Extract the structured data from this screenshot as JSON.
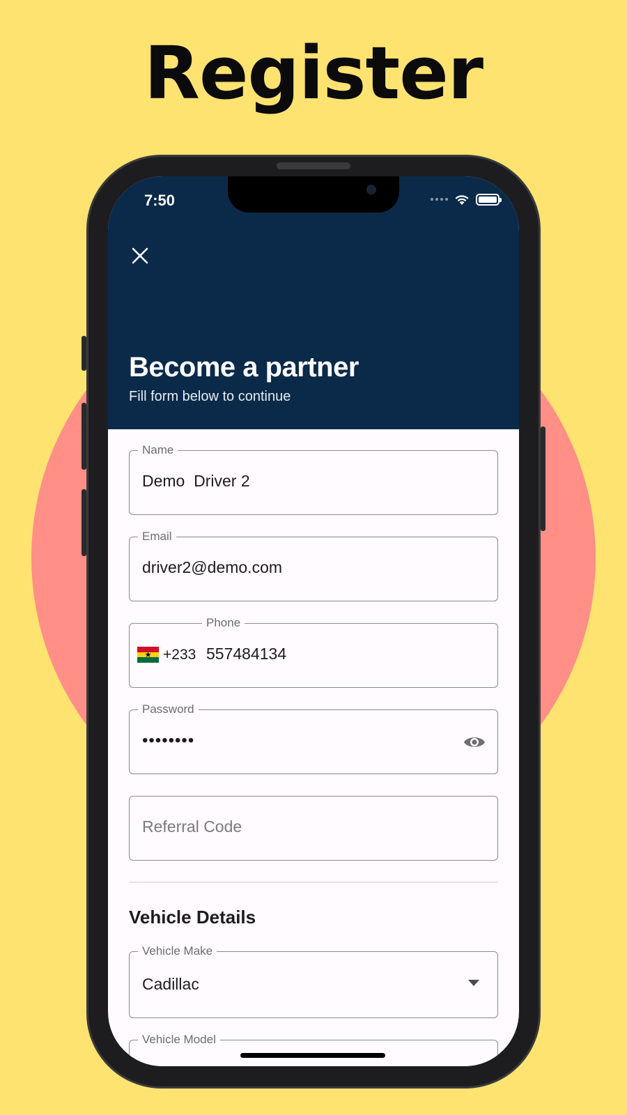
{
  "headline": "Register",
  "status_bar": {
    "time": "7:50"
  },
  "header": {
    "title": "Become a partner",
    "subtitle": "Fill form below to continue"
  },
  "form": {
    "name": {
      "label": "Name",
      "value": "Demo  Driver 2"
    },
    "email": {
      "label": "Email",
      "value": "driver2@demo.com"
    },
    "phone": {
      "label": "Phone",
      "dial_code": "+233",
      "value": "557484134",
      "country_flag": "ghana-flag"
    },
    "password": {
      "label": "Password",
      "value": "••••••••"
    },
    "referral": {
      "placeholder": "Referral Code"
    }
  },
  "vehicle": {
    "section_title": "Vehicle Details",
    "make": {
      "label": "Vehicle Make",
      "value": "Cadillac"
    },
    "model": {
      "label": "Vehicle Model"
    }
  },
  "colors": {
    "background": "#FFE371",
    "circle": "#FF8F87",
    "header": "#0B2A4A"
  }
}
